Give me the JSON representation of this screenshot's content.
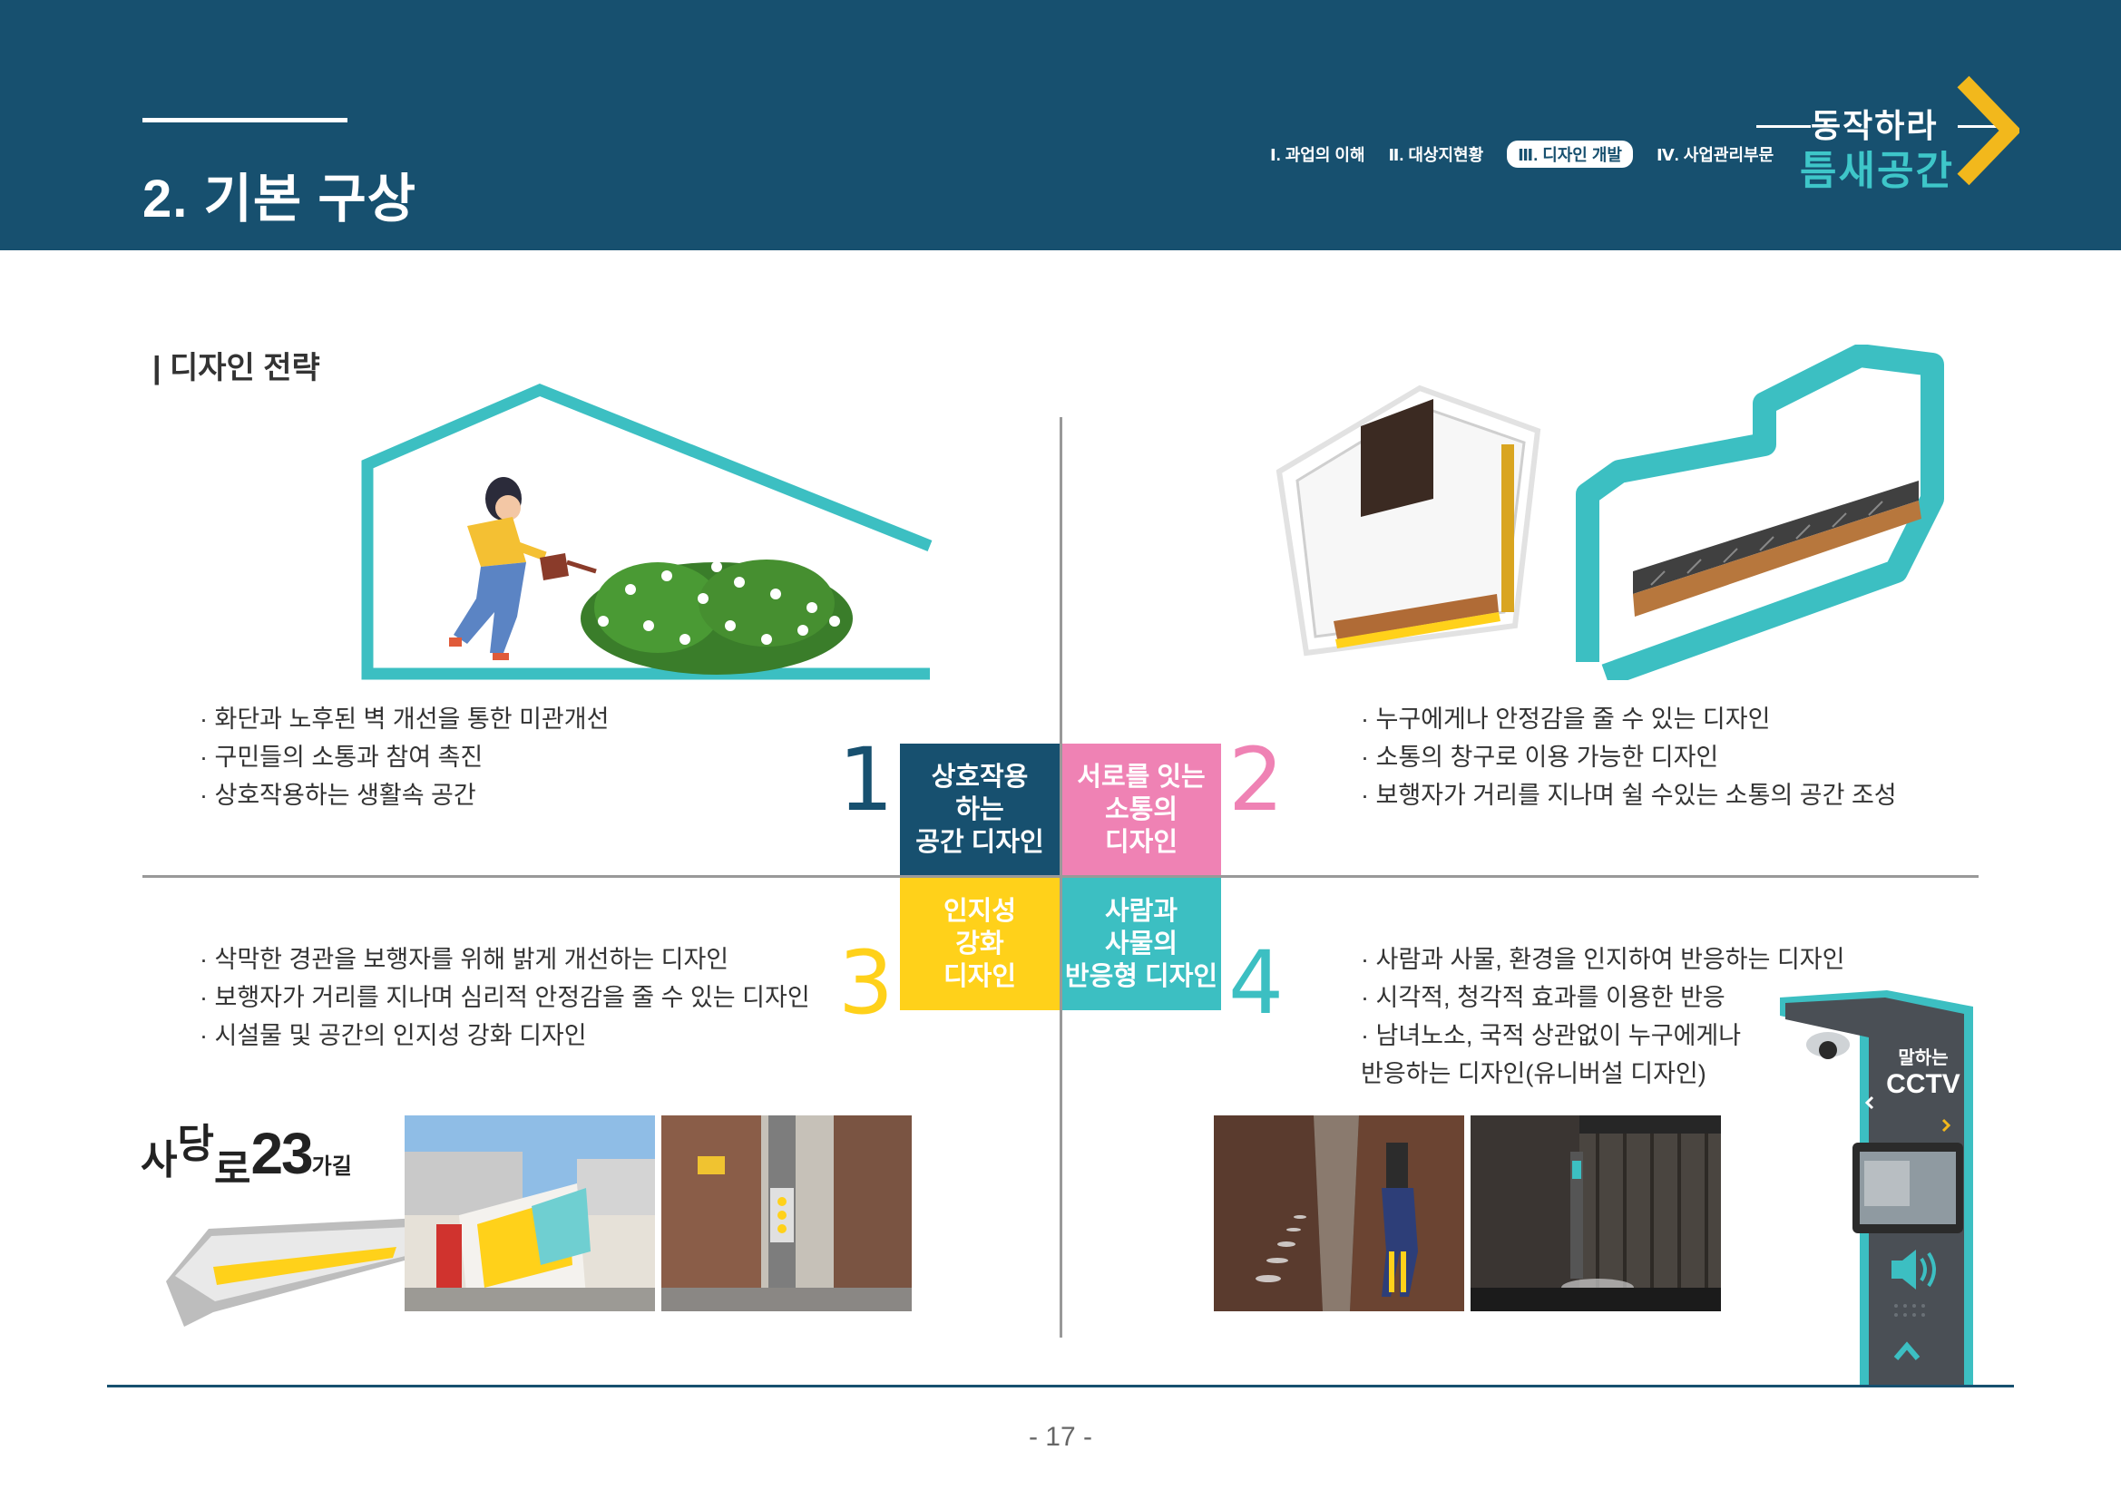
{
  "header": {
    "title": "2. 기본 구상",
    "nav": [
      {
        "label": "Ⅰ. 과업의 이해",
        "active": false
      },
      {
        "label": "Ⅱ. 대상지현황",
        "active": false
      },
      {
        "label": "Ⅲ. 디자인 개발",
        "active": true
      },
      {
        "label": "Ⅳ. 사업관리부문",
        "active": false
      }
    ],
    "logo": {
      "top": "동작하라",
      "bottom": "틈새공간"
    }
  },
  "section_heading": "| 디자인 전략",
  "quadrants": [
    {
      "number": "1",
      "label": "상호작용\n하는\n공간 디자인",
      "color": "#17506f",
      "bullets": [
        "· 화단과 노후된 벽 개선을 통한 미관개선",
        "· 구민들의 소통과 참여 촉진",
        "· 상호작용하는 생활속 공간"
      ]
    },
    {
      "number": "2",
      "label": "서로를 잇는\n소통의\n디자인",
      "color": "#ef82b4",
      "bullets": [
        "· 누구에게나 안정감을 줄 수 있는 디자인",
        "· 소통의 창구로 이용 가능한 디자인",
        "· 보행자가 거리를 지나며 쉴 수있는 소통의 공간 조성"
      ]
    },
    {
      "number": "3",
      "label": "인지성\n강화\n디자인",
      "color": "#ffd11a",
      "bullets": [
        "· 삭막한 경관을 보행자를 위해 밝게 개선하는 디자인",
        "· 보행자가 거리를 지나며 심리적 안정감을 줄 수 있는 디자인",
        "· 시설물 및 공간의 인지성 강화 디자인"
      ]
    },
    {
      "number": "4",
      "label": "사람과\n사물의\n반응형 디자인",
      "color": "#3cbfc2",
      "bullets": [
        "· 사람과 사물, 환경을 인지하여 반응하는 디자인",
        "· 시각적, 청각적 효과를 이용한 반응",
        "· 남녀노소, 국적 상관없이 누구에게나",
        "  반응하는 디자인(유니버설 디자인)"
      ]
    }
  ],
  "sadang": {
    "a": "사",
    "b": "당",
    "c": "로",
    "num": "23",
    "suffix": "가길"
  },
  "cctv": {
    "label_top": "말하는",
    "label_bottom": "CCTV"
  },
  "page_number": "- 17 -",
  "colors": {
    "navy": "#17506f",
    "teal": "#3cbfc2",
    "pink": "#ef82b4",
    "yellow": "#ffd11a"
  }
}
